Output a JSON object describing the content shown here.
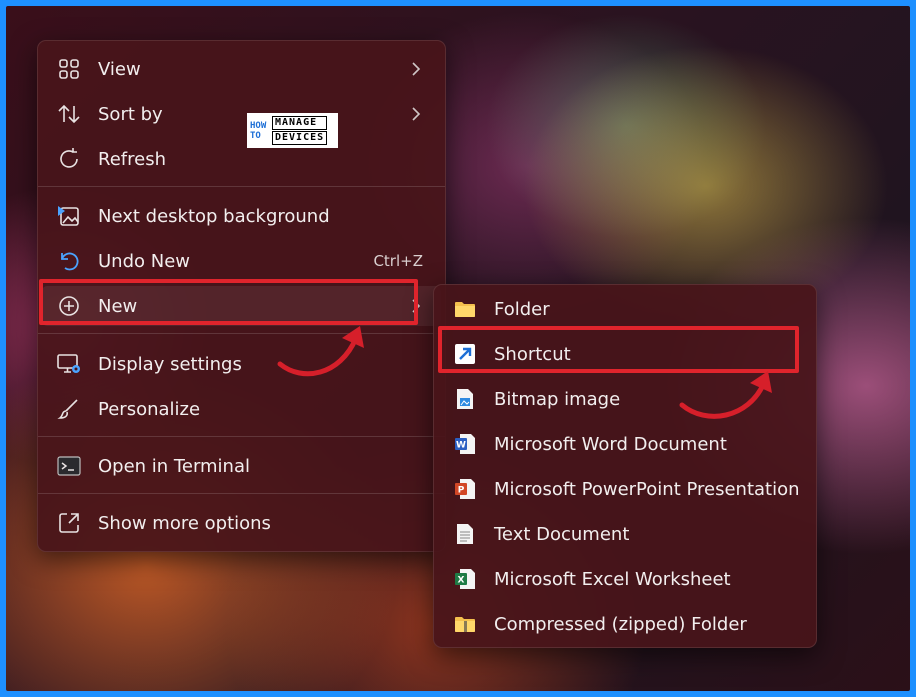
{
  "main_menu": {
    "items": [
      {
        "label": "View"
      },
      {
        "label": "Sort by"
      },
      {
        "label": "Refresh"
      },
      {
        "label": "Next desktop background"
      },
      {
        "label": "Undo New",
        "shortcut": "Ctrl+Z"
      },
      {
        "label": "New"
      },
      {
        "label": "Display settings"
      },
      {
        "label": "Personalize"
      },
      {
        "label": "Open in Terminal"
      },
      {
        "label": "Show more options"
      }
    ]
  },
  "sub_menu": {
    "items": [
      {
        "label": "Folder"
      },
      {
        "label": "Shortcut"
      },
      {
        "label": "Bitmap image"
      },
      {
        "label": "Microsoft Word Document"
      },
      {
        "label": "Microsoft PowerPoint Presentation"
      },
      {
        "label": "Text Document"
      },
      {
        "label": "Microsoft Excel Worksheet"
      },
      {
        "label": "Compressed (zipped) Folder"
      }
    ]
  },
  "logo": {
    "how": "HOW",
    "to": "TO",
    "manage": "MANAGE",
    "devices": "DEVICES"
  },
  "colors": {
    "highlight": "#e0242c",
    "accent": "#4aa3ff",
    "menu_bg": "#48141a"
  }
}
